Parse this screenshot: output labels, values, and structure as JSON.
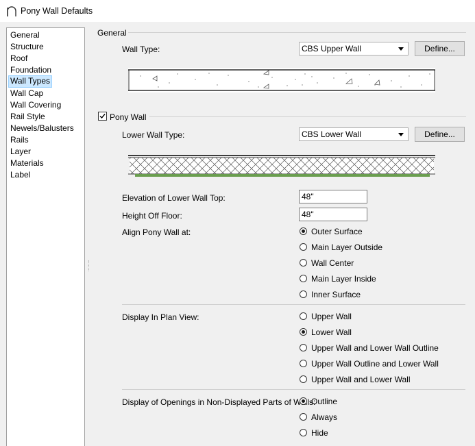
{
  "window": {
    "title": "Pony Wall Defaults"
  },
  "sidebar": {
    "items": [
      {
        "label": "General"
      },
      {
        "label": "Structure"
      },
      {
        "label": "Roof"
      },
      {
        "label": "Foundation"
      },
      {
        "label": "Wall Types",
        "selected": true
      },
      {
        "label": "Wall Cap"
      },
      {
        "label": "Wall Covering"
      },
      {
        "label": "Rail Style"
      },
      {
        "label": "Newels/Balusters"
      },
      {
        "label": "Rails"
      },
      {
        "label": "Layer"
      },
      {
        "label": "Materials"
      },
      {
        "label": "Label"
      }
    ]
  },
  "general": {
    "section_title": "General",
    "wall_type_label": "Wall Type:",
    "wall_type_value": "CBS Upper Wall",
    "define_label": "Define..."
  },
  "pony_wall": {
    "checkbox_label": "Pony Wall",
    "checked": true,
    "lower_wall_type_label": "Lower Wall Type:",
    "lower_wall_type_value": "CBS Lower Wall",
    "define_label": "Define...",
    "elevation_label": "Elevation of Lower Wall Top:",
    "elevation_value": "48\"",
    "height_label": "Height Off Floor:",
    "height_value": "48\"",
    "align_label": "Align Pony Wall at:",
    "align_options": [
      {
        "label": "Outer Surface",
        "selected": true
      },
      {
        "label": "Main Layer Outside",
        "selected": false
      },
      {
        "label": "Wall Center",
        "selected": false
      },
      {
        "label": "Main Layer Inside",
        "selected": false
      },
      {
        "label": "Inner Surface",
        "selected": false
      }
    ],
    "display_label": "Display In Plan View:",
    "display_options": [
      {
        "label": "Upper Wall",
        "selected": false
      },
      {
        "label": "Lower Wall",
        "selected": true
      },
      {
        "label": "Upper Wall and Lower Wall Outline",
        "selected": false
      },
      {
        "label": "Upper Wall Outline and Lower Wall",
        "selected": false
      },
      {
        "label": "Upper Wall and Lower Wall",
        "selected": false
      }
    ],
    "openings_label": "Display of Openings in Non-Displayed Parts of Walls:",
    "openings_options": [
      {
        "label": "Outline",
        "selected": true
      },
      {
        "label": "Always",
        "selected": false
      },
      {
        "label": "Hide",
        "selected": false
      }
    ]
  },
  "colors": {
    "selection_bg": "#cce8ff",
    "selection_border": "#99d1ff",
    "wall_finish_green": "#6a9e4f"
  }
}
